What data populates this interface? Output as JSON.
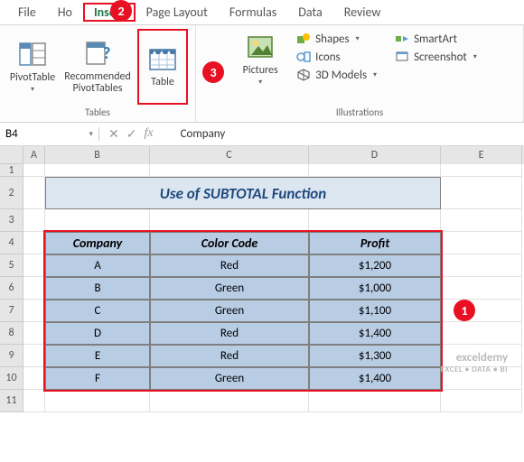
{
  "menu": {
    "tabs": [
      "File",
      "Ho",
      "Insert",
      "Page Layout",
      "Formulas",
      "Data",
      "Review"
    ],
    "active": "Insert"
  },
  "ribbon": {
    "tables_group_label": "Tables",
    "illus_group_label": "Illustrations",
    "pivottable": "PivotTable",
    "recommended": "Recommended\nPivotTables",
    "table": "Table",
    "pictures": "Pictures",
    "shapes": "Shapes",
    "icons": "Icons",
    "models3d": "3D Models",
    "smartart": "SmartArt",
    "screenshot": "Screenshot"
  },
  "namebox": {
    "value": "B4"
  },
  "formula_value": "Company",
  "columns": [
    "A",
    "B",
    "C",
    "D",
    "E"
  ],
  "rows": [
    "1",
    "2",
    "3",
    "4",
    "5",
    "6",
    "7",
    "8",
    "9",
    "10",
    "11"
  ],
  "title_cell": "Use of SUBTOTAL Function",
  "table_headers": [
    "Company",
    "Color Code",
    "Profit"
  ],
  "table_rows": [
    {
      "company": "A",
      "color": "Red",
      "profit": "$1,200"
    },
    {
      "company": "B",
      "color": "Green",
      "profit": "$1,000"
    },
    {
      "company": "C",
      "color": "Green",
      "profit": "$1,100"
    },
    {
      "company": "D",
      "color": "Red",
      "profit": "$1,400"
    },
    {
      "company": "E",
      "color": "Red",
      "profit": "$1,300"
    },
    {
      "company": "F",
      "color": "Green",
      "profit": "$1,400"
    }
  ],
  "callouts": {
    "c1": "1",
    "c2": "2",
    "c3": "3"
  },
  "watermark": {
    "main": "exceldemy",
    "sub": "EXCEL • DATA • BI"
  }
}
